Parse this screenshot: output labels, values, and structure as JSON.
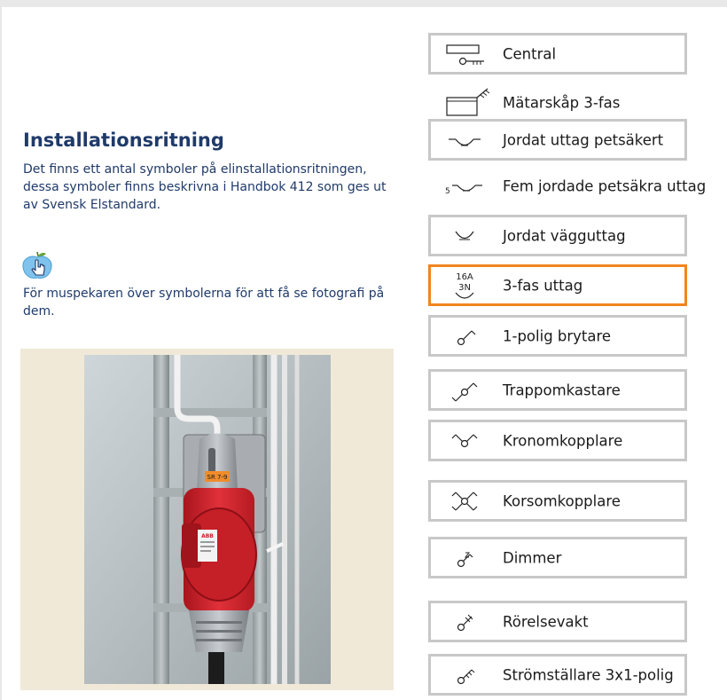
{
  "content": {
    "title": "Installationsritning",
    "intro": "Det finns ett antal symboler på elinstallationsritningen, dessa symboler finns beskrivna i Handbok 412 som ges ut av Svensk Elstandard.",
    "hint": "För muspekaren över symbolerna för att få se fotografi på dem."
  },
  "photo": {
    "sticker_text": "SR 7-9",
    "brand_text": "ABB"
  },
  "symbols": [
    {
      "label": "Central",
      "icon": "central-symbol"
    },
    {
      "label": "Mätarskåp 3-fas",
      "icon": "meter-cabinet-symbol"
    },
    {
      "label": "Jordat uttag petsäkert",
      "icon": "grounded-outlet-child-safe-symbol"
    },
    {
      "label": "Fem jordade petsäkra uttag",
      "icon": "five-grounded-outlets-symbol",
      "count": "5"
    },
    {
      "label": "Jordat vägguttag",
      "icon": "grounded-wall-outlet-symbol"
    },
    {
      "label": "3-fas uttag",
      "icon": "three-phase-outlet-symbol",
      "rating": "16A",
      "poles": "3N",
      "selected": true
    },
    {
      "label": "1-polig brytare",
      "icon": "single-pole-switch-symbol"
    },
    {
      "label": "Trappomkastare",
      "icon": "two-way-switch-symbol"
    },
    {
      "label": "Kronomkopplare",
      "icon": "crown-switch-symbol"
    },
    {
      "label": "Korsomkopplare",
      "icon": "cross-switch-symbol"
    },
    {
      "label": "Dimmer",
      "icon": "dimmer-symbol"
    },
    {
      "label": "Rörelsevakt",
      "icon": "motion-sensor-symbol"
    },
    {
      "label": "Strömställare 3x1-polig",
      "icon": "triple-single-pole-switch-symbol"
    }
  ],
  "colors": {
    "heading": "#1f3a6a",
    "item_border": "#c8c8c8",
    "selected_border": "#f0851f",
    "photo_background": "#f1e9d8"
  }
}
